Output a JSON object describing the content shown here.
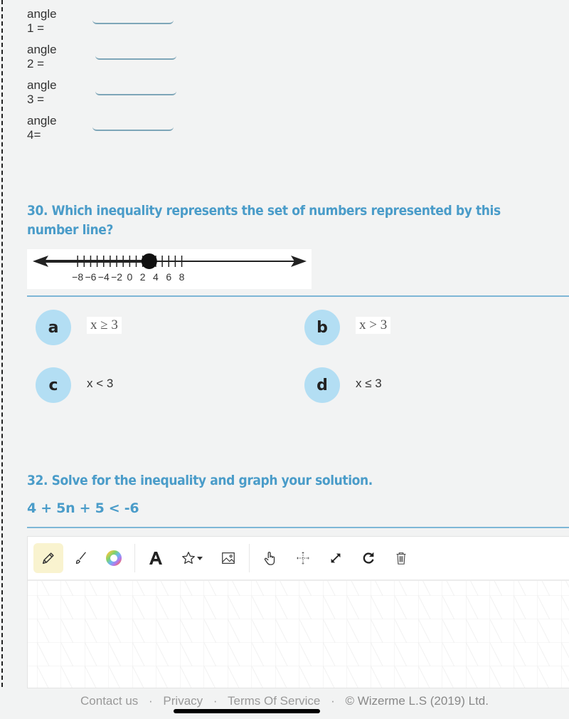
{
  "angles": [
    {
      "label": "angle 1 =",
      "value": ""
    },
    {
      "label": "angle 2 =",
      "value": ""
    },
    {
      "label": "angle 3 =",
      "value": ""
    },
    {
      "label": "angle 4=",
      "value": ""
    }
  ],
  "question30": {
    "title": "30. Which inequality represents the set of numbers represented by this number line?",
    "number_line": {
      "tick_labels": [
        "−8",
        "−6",
        "−4",
        "−2",
        "0",
        "2",
        "4",
        "6",
        "8"
      ],
      "range": [
        -9,
        9
      ],
      "point": 3,
      "point_style": "closed",
      "shaded_direction": "left"
    },
    "options": [
      {
        "letter": "a",
        "text": "x ≥ 3",
        "style": "image"
      },
      {
        "letter": "b",
        "text": "x > 3",
        "style": "image"
      },
      {
        "letter": "c",
        "text": "x < 3",
        "style": "text"
      },
      {
        "letter": "d",
        "text": "x ≤ 3",
        "style": "text"
      }
    ]
  },
  "question32": {
    "title": "32. Solve for the inequality and graph your solution.",
    "expression": "4 + 5n + 5 < -6"
  },
  "toolbar": {
    "tools": [
      "pencil-icon",
      "brush-icon",
      "color-wheel-icon",
      "text-icon",
      "star-shape-icon",
      "image-icon",
      "hand-icon",
      "move-icon",
      "resize-icon",
      "redo-icon",
      "trash-icon"
    ],
    "active_tool": "pencil-icon"
  },
  "colors": {
    "accent": "#4a9cc9",
    "bubble": "#b3def3",
    "active_tool_bg": "#f9f3cf"
  },
  "footer": {
    "contact": "Contact us",
    "privacy": "Privacy",
    "terms": "Terms Of Service",
    "copyright": "© Wizerme L.S (2019) Ltd.",
    "separator": "·"
  }
}
